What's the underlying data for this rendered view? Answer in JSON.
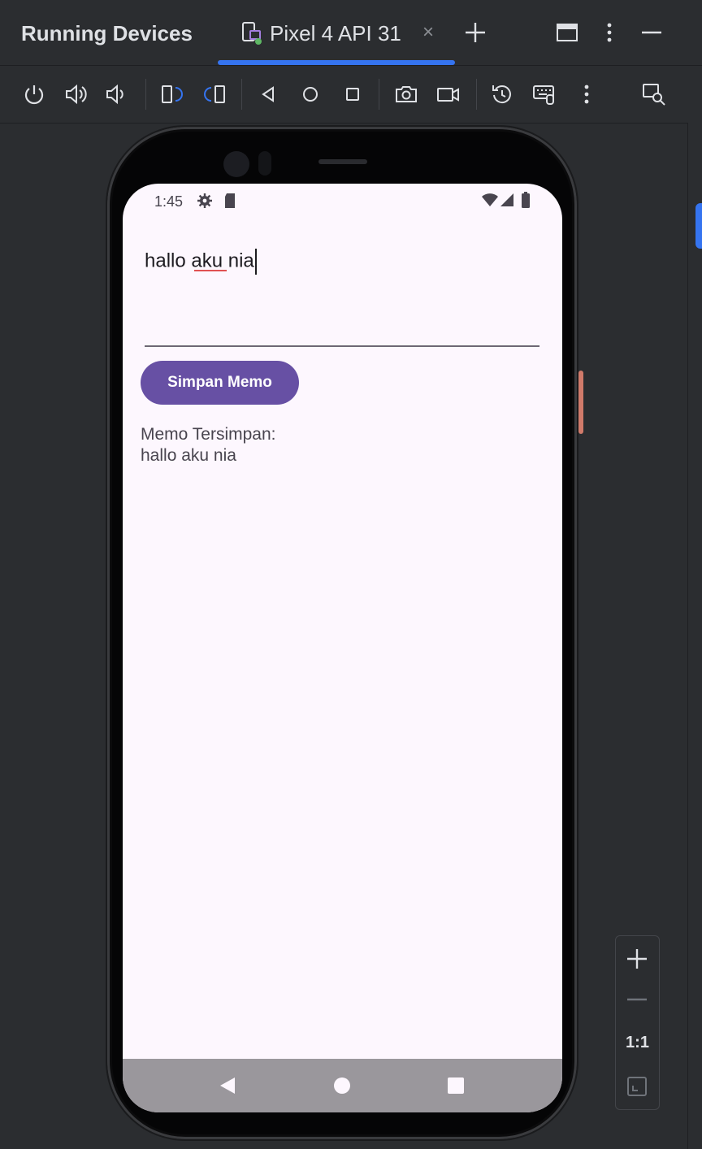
{
  "window": {
    "title": "Running Devices",
    "tab_label": "Pixel 4 API 31",
    "tab_close": "×"
  },
  "toolbar": {
    "icons": [
      "power-icon",
      "volume-up-icon",
      "volume-down-icon",
      "rotate-left-icon",
      "rotate-right-icon",
      "back-icon",
      "home-icon",
      "overview-icon",
      "screenshot-icon",
      "screen-record-icon",
      "reset-icon",
      "keyboard-icon",
      "more-icon",
      "device-inspector-icon"
    ]
  },
  "device": {
    "status_time": "1:45"
  },
  "app": {
    "memo_input_value": "hallo aku nia",
    "save_button_label": "Simpan Memo",
    "saved_label": "Memo Tersimpan:",
    "saved_value": "hallo aku nia"
  },
  "zoom": {
    "ratio_label": "1:1"
  },
  "colors": {
    "accent": "#3574f0",
    "primary": "#6750a4",
    "background": "#fdf7fe"
  }
}
